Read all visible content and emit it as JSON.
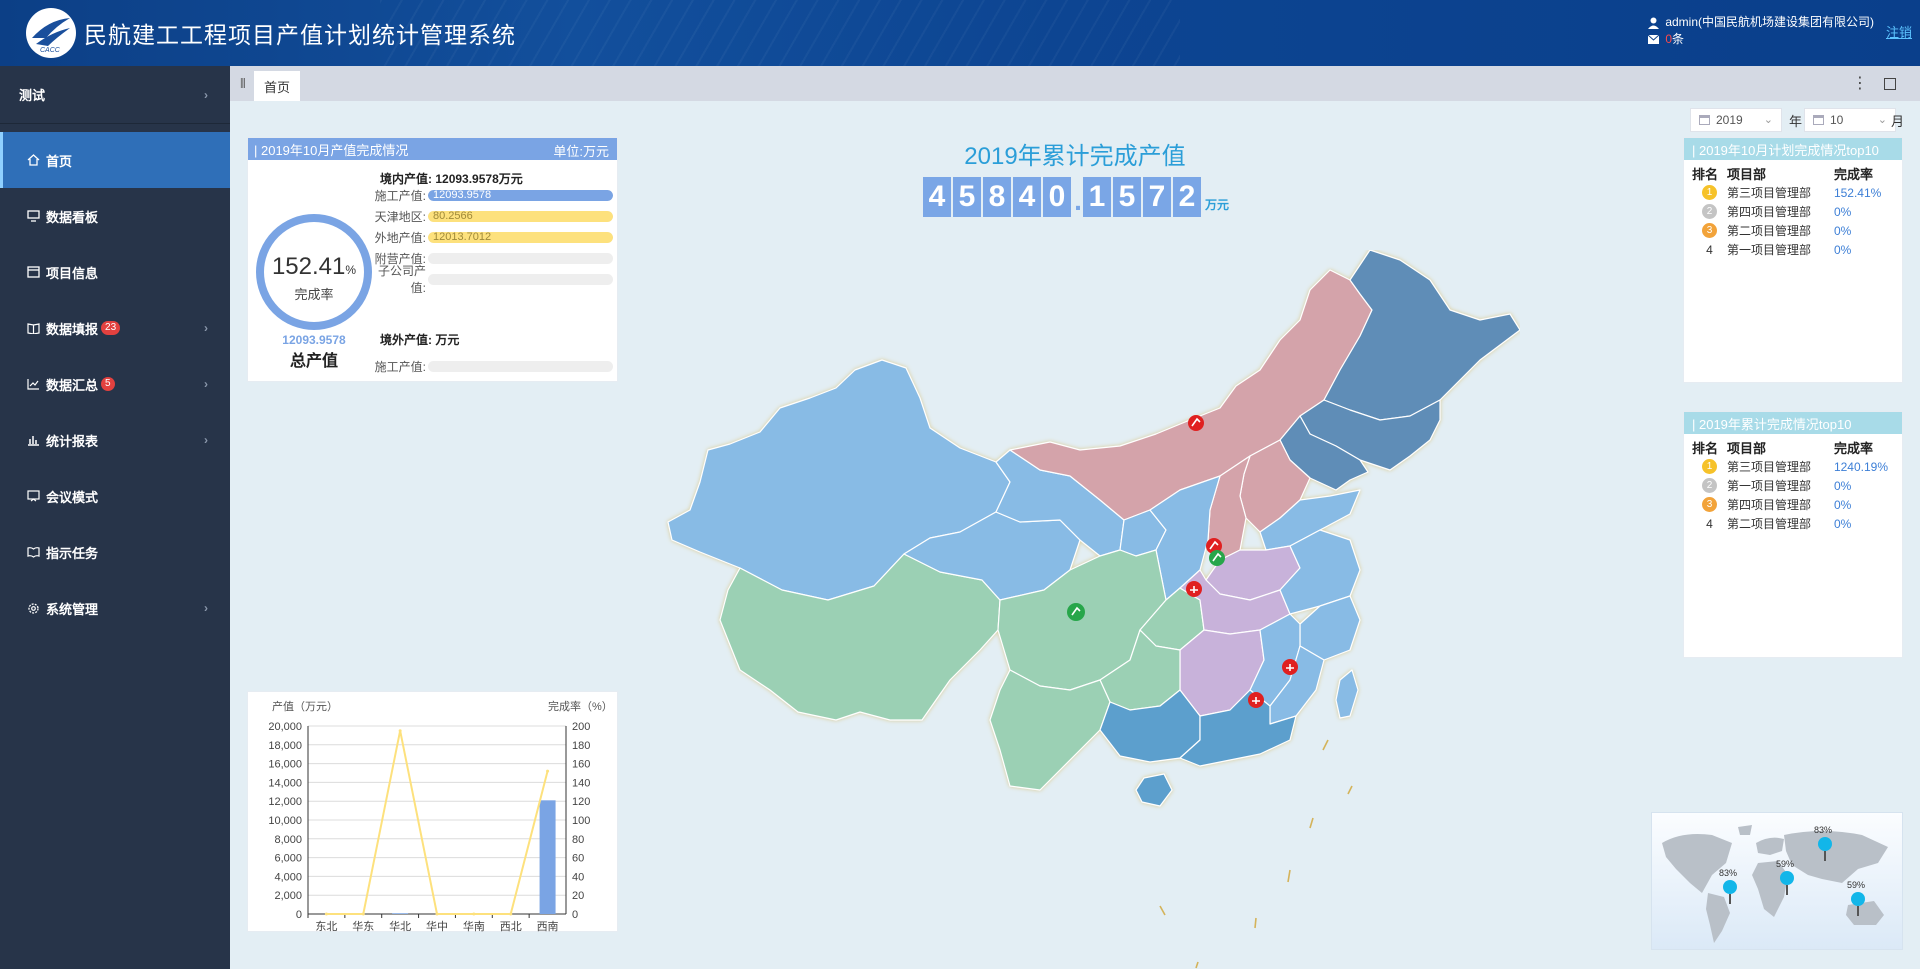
{
  "header": {
    "title": "民航建工工程项目产值计划统计管理系统",
    "user": "admin(中国民航机场建设集团有限公司)",
    "msg_count": "0",
    "msg_unit": "条",
    "logout": "注销"
  },
  "sidebar": {
    "top": "测试",
    "items": [
      {
        "label": "首页",
        "icon": "home-icon"
      },
      {
        "label": "数据看板",
        "icon": "monitor-icon"
      },
      {
        "label": "项目信息",
        "icon": "window-icon"
      },
      {
        "label": "数据填报",
        "icon": "book-icon",
        "badge": "23"
      },
      {
        "label": "数据汇总",
        "icon": "line-chart-icon",
        "badge": "5"
      },
      {
        "label": "统计报表",
        "icon": "bar-chart-icon"
      },
      {
        "label": "会议模式",
        "icon": "meeting-icon"
      },
      {
        "label": "指示任务",
        "icon": "book-open-icon"
      },
      {
        "label": "系统管理",
        "icon": "gear-icon"
      }
    ]
  },
  "tabs": {
    "home": "首页"
  },
  "month_panel": {
    "title": "| 2019年10月产值完成情况",
    "unit": "单位:万元",
    "rate": "152.41",
    "rate_pct": "%",
    "rate_label": "完成率",
    "total_value": "12093.9578",
    "total_label": "总产值",
    "domestic_label": "境内产值:",
    "domestic_value": "12093.9578万元",
    "overseas_label": "境外产值:",
    "overseas_value": "万元",
    "bars": [
      {
        "label": "施工产值:",
        "value": "12093.9578",
        "fraction": 1.0,
        "color": "#7aa4e4"
      },
      {
        "label": "天津地区:",
        "value": "80.2566",
        "fraction": 1.0,
        "color": "#fde17d"
      },
      {
        "label": "外地产值:",
        "value": "12013.7012",
        "fraction": 1.0,
        "color": "#fde17d"
      },
      {
        "label": "附营产值:",
        "value": "",
        "fraction": 0,
        "color": "#7aa4e4"
      },
      {
        "label": "子公司产值:",
        "value": "",
        "fraction": 0,
        "color": "#7aa4e4"
      }
    ],
    "overseas_bars": [
      {
        "label": "施工产值:",
        "value": "",
        "fraction": 0,
        "color": "#7aa4e4"
      }
    ]
  },
  "center": {
    "title": "2019年累计完成产值",
    "digits": [
      "4",
      "5",
      "8",
      "4",
      "0",
      ".",
      "1",
      "5",
      "7",
      "2"
    ],
    "unit": "万元"
  },
  "date": {
    "year": "2019",
    "year_label": "年",
    "month": "10",
    "month_label": "月"
  },
  "top_plan": {
    "title": "| 2019年10月计划完成情况top10",
    "headers": {
      "rank": "排名",
      "dept": "项目部",
      "rate": "完成率"
    },
    "rows": [
      {
        "rank": "1",
        "dept": "第三项目管理部",
        "rate": "152.41%"
      },
      {
        "rank": "2",
        "dept": "第四项目管理部",
        "rate": "0%"
      },
      {
        "rank": "3",
        "dept": "第二项目管理部",
        "rate": "0%"
      },
      {
        "rank": "4",
        "dept": "第一项目管理部",
        "rate": "0%"
      }
    ]
  },
  "top_cumulative": {
    "title": "| 2019年累计完成情况top10",
    "headers": {
      "rank": "排名",
      "dept": "项目部",
      "rate": "完成率"
    },
    "rows": [
      {
        "rank": "1",
        "dept": "第三项目管理部",
        "rate": "1240.19%"
      },
      {
        "rank": "2",
        "dept": "第一项目管理部",
        "rate": "0%"
      },
      {
        "rank": "3",
        "dept": "第四项目管理部",
        "rate": "0%"
      },
      {
        "rank": "4",
        "dept": "第二项目管理部",
        "rate": "0%"
      }
    ]
  },
  "world": {
    "pins": [
      "83%",
      "59%",
      "83%",
      "59%"
    ]
  },
  "colors": {
    "medal_gold": "#f6c22a",
    "medal_silver": "#c4c4c4",
    "medal_bronze": "#f2a33a",
    "bar": "#7aa4e4",
    "line": "#fde17d"
  },
  "chart_data": {
    "type": "bar",
    "ylabel": "产值（万元）",
    "y2label": "完成率（%）",
    "categories": [
      "东北",
      "华东",
      "华北",
      "华中",
      "华南",
      "西北",
      "西南"
    ],
    "yticks": [
      "0",
      "2,000",
      "4,000",
      "6,000",
      "8,000",
      "10,000",
      "12,000",
      "14,000",
      "16,000",
      "18,000",
      "20,000"
    ],
    "y2ticks": [
      "0",
      "20",
      "40",
      "60",
      "80",
      "100",
      "120",
      "140",
      "160",
      "180",
      "200"
    ],
    "ylim": [
      0,
      20000
    ],
    "y2lim": [
      0,
      200
    ],
    "series": [
      {
        "type": "bar",
        "values": [
          0,
          0,
          80,
          0,
          0,
          0,
          12094
        ]
      },
      {
        "type": "line",
        "axis": "right",
        "values": [
          0,
          0,
          195,
          0,
          0,
          0,
          152
        ]
      }
    ]
  }
}
